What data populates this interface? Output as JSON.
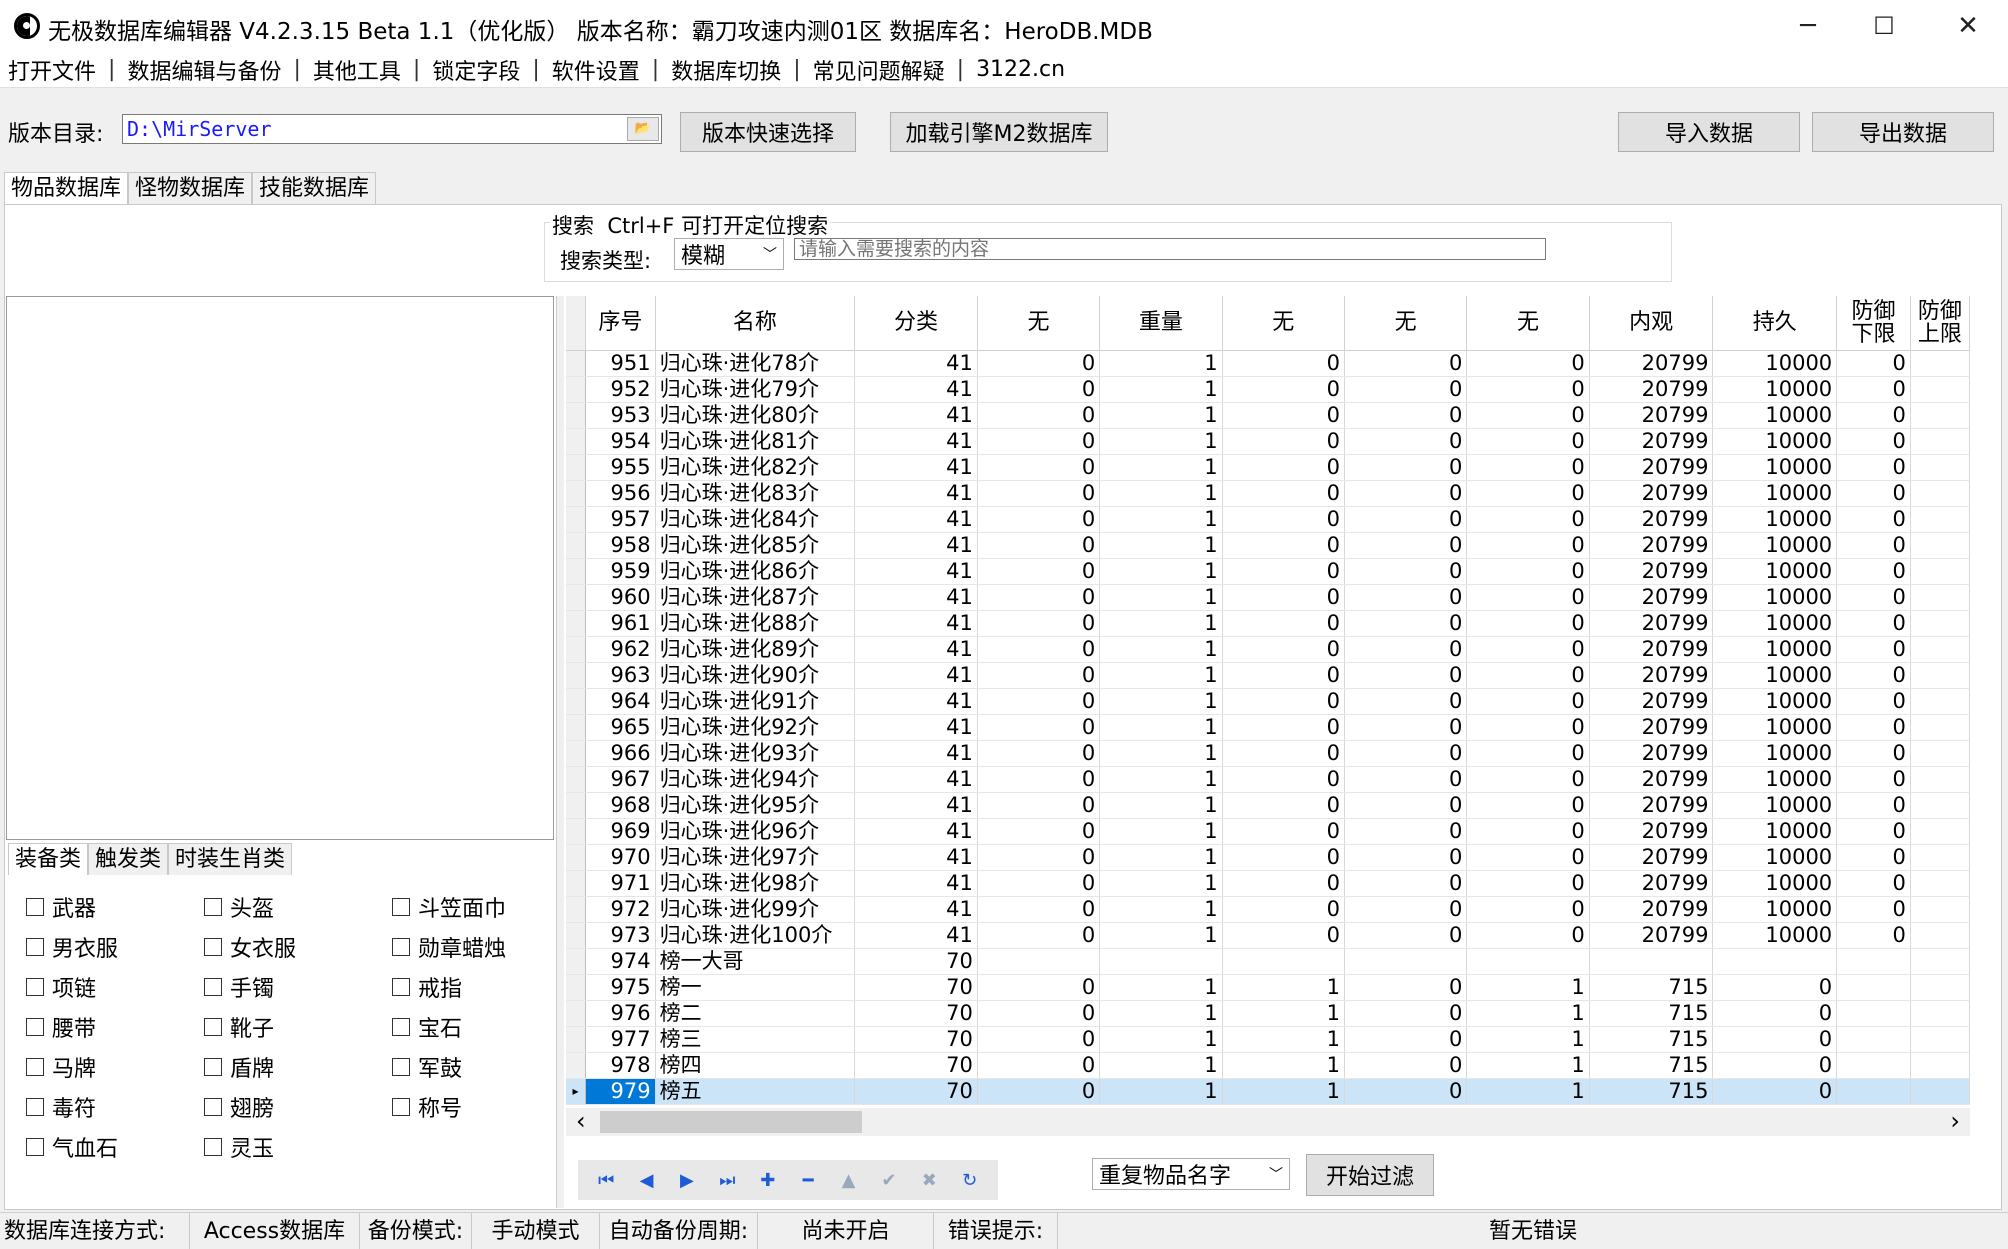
{
  "window": {
    "title": "无极数据库编辑器 V4.2.3.15    Beta 1.1（优化版）    版本名称：霸刀攻速内测01区    数据库名：HeroDB.MDB",
    "minimize": "─",
    "maximize": "☐",
    "close": "✕"
  },
  "menu": [
    "打开文件",
    "数据编辑与备份",
    "其他工具",
    "锁定字段",
    "软件设置",
    "数据库切换",
    "常见问题解疑",
    "3122.cn"
  ],
  "menu_sep": "|",
  "toolbar": {
    "dir_label": "版本目录:",
    "dir_value": "D:\\MirServer",
    "folder_icon": "📂",
    "quick_select": "版本快速选择",
    "load_engine": "加载引擎M2数据库",
    "import": "导入数据",
    "export": "导出数据"
  },
  "db_tabs": [
    "物品数据库",
    "怪物数据库",
    "技能数据库"
  ],
  "search": {
    "title": "搜索  Ctrl+F 可打开定位搜索",
    "type_label": "搜索类型:",
    "type_value": "模糊",
    "placeholder": "请输入需要搜索的内容"
  },
  "category_tabs": [
    "装备类",
    "触发类",
    "时装生肖类"
  ],
  "categories": [
    [
      "武器",
      "头盔",
      "斗笠面巾"
    ],
    [
      "男衣服",
      "女衣服",
      "勋章蜡烛"
    ],
    [
      "项链",
      "手镯",
      "戒指"
    ],
    [
      "腰带",
      "靴子",
      "宝石"
    ],
    [
      "马牌",
      "盾牌",
      "军鼓"
    ],
    [
      "毒符",
      "翅膀",
      "称号"
    ],
    [
      "气血石",
      "灵玉",
      ""
    ]
  ],
  "grid": {
    "columns": [
      "序号",
      "名称",
      "分类",
      "无",
      "重量",
      "无",
      "无",
      "无",
      "内观",
      "持久",
      "防御\n下限",
      "防御\n上限"
    ],
    "rows": [
      [
        "951",
        "归心珠·进化78介",
        "41",
        "0",
        "1",
        "0",
        "0",
        "0",
        "20799",
        "10000",
        "0",
        ""
      ],
      [
        "952",
        "归心珠·进化79介",
        "41",
        "0",
        "1",
        "0",
        "0",
        "0",
        "20799",
        "10000",
        "0",
        ""
      ],
      [
        "953",
        "归心珠·进化80介",
        "41",
        "0",
        "1",
        "0",
        "0",
        "0",
        "20799",
        "10000",
        "0",
        ""
      ],
      [
        "954",
        "归心珠·进化81介",
        "41",
        "0",
        "1",
        "0",
        "0",
        "0",
        "20799",
        "10000",
        "0",
        ""
      ],
      [
        "955",
        "归心珠·进化82介",
        "41",
        "0",
        "1",
        "0",
        "0",
        "0",
        "20799",
        "10000",
        "0",
        ""
      ],
      [
        "956",
        "归心珠·进化83介",
        "41",
        "0",
        "1",
        "0",
        "0",
        "0",
        "20799",
        "10000",
        "0",
        ""
      ],
      [
        "957",
        "归心珠·进化84介",
        "41",
        "0",
        "1",
        "0",
        "0",
        "0",
        "20799",
        "10000",
        "0",
        ""
      ],
      [
        "958",
        "归心珠·进化85介",
        "41",
        "0",
        "1",
        "0",
        "0",
        "0",
        "20799",
        "10000",
        "0",
        ""
      ],
      [
        "959",
        "归心珠·进化86介",
        "41",
        "0",
        "1",
        "0",
        "0",
        "0",
        "20799",
        "10000",
        "0",
        ""
      ],
      [
        "960",
        "归心珠·进化87介",
        "41",
        "0",
        "1",
        "0",
        "0",
        "0",
        "20799",
        "10000",
        "0",
        ""
      ],
      [
        "961",
        "归心珠·进化88介",
        "41",
        "0",
        "1",
        "0",
        "0",
        "0",
        "20799",
        "10000",
        "0",
        ""
      ],
      [
        "962",
        "归心珠·进化89介",
        "41",
        "0",
        "1",
        "0",
        "0",
        "0",
        "20799",
        "10000",
        "0",
        ""
      ],
      [
        "963",
        "归心珠·进化90介",
        "41",
        "0",
        "1",
        "0",
        "0",
        "0",
        "20799",
        "10000",
        "0",
        ""
      ],
      [
        "964",
        "归心珠·进化91介",
        "41",
        "0",
        "1",
        "0",
        "0",
        "0",
        "20799",
        "10000",
        "0",
        ""
      ],
      [
        "965",
        "归心珠·进化92介",
        "41",
        "0",
        "1",
        "0",
        "0",
        "0",
        "20799",
        "10000",
        "0",
        ""
      ],
      [
        "966",
        "归心珠·进化93介",
        "41",
        "0",
        "1",
        "0",
        "0",
        "0",
        "20799",
        "10000",
        "0",
        ""
      ],
      [
        "967",
        "归心珠·进化94介",
        "41",
        "0",
        "1",
        "0",
        "0",
        "0",
        "20799",
        "10000",
        "0",
        ""
      ],
      [
        "968",
        "归心珠·进化95介",
        "41",
        "0",
        "1",
        "0",
        "0",
        "0",
        "20799",
        "10000",
        "0",
        ""
      ],
      [
        "969",
        "归心珠·进化96介",
        "41",
        "0",
        "1",
        "0",
        "0",
        "0",
        "20799",
        "10000",
        "0",
        ""
      ],
      [
        "970",
        "归心珠·进化97介",
        "41",
        "0",
        "1",
        "0",
        "0",
        "0",
        "20799",
        "10000",
        "0",
        ""
      ],
      [
        "971",
        "归心珠·进化98介",
        "41",
        "0",
        "1",
        "0",
        "0",
        "0",
        "20799",
        "10000",
        "0",
        ""
      ],
      [
        "972",
        "归心珠·进化99介",
        "41",
        "0",
        "1",
        "0",
        "0",
        "0",
        "20799",
        "10000",
        "0",
        ""
      ],
      [
        "973",
        "归心珠·进化100介",
        "41",
        "0",
        "1",
        "0",
        "0",
        "0",
        "20799",
        "10000",
        "0",
        ""
      ],
      [
        "974",
        "榜一大哥",
        "70",
        "",
        "",
        "",
        "",
        "",
        "",
        "",
        "",
        ""
      ],
      [
        "975",
        "榜一",
        "70",
        "0",
        "1",
        "1",
        "0",
        "1",
        "715",
        "0",
        "",
        ""
      ],
      [
        "976",
        "榜二",
        "70",
        "0",
        "1",
        "1",
        "0",
        "1",
        "715",
        "0",
        "",
        ""
      ],
      [
        "977",
        "榜三",
        "70",
        "0",
        "1",
        "1",
        "0",
        "1",
        "715",
        "0",
        "",
        ""
      ],
      [
        "978",
        "榜四",
        "70",
        "0",
        "1",
        "1",
        "0",
        "1",
        "715",
        "0",
        "",
        ""
      ],
      [
        "979",
        "榜五",
        "70",
        "0",
        "1",
        "1",
        "0",
        "1",
        "715",
        "0",
        "",
        ""
      ]
    ],
    "selected_row": "979"
  },
  "scroll": {
    "left": "‹",
    "right": "›"
  },
  "nav_buttons": [
    {
      "icon": "first-icon",
      "glyph": "⏮"
    },
    {
      "icon": "prev-icon",
      "glyph": "◀"
    },
    {
      "icon": "next-icon",
      "glyph": "▶"
    },
    {
      "icon": "last-icon",
      "glyph": "⏭"
    },
    {
      "icon": "add-icon",
      "glyph": "✚"
    },
    {
      "icon": "delete-icon",
      "glyph": "━"
    },
    {
      "icon": "edit-icon",
      "glyph": "▲"
    },
    {
      "icon": "post-icon",
      "glyph": "✔"
    },
    {
      "icon": "cancel-icon",
      "glyph": "✖"
    },
    {
      "icon": "refresh-icon",
      "glyph": "↻"
    }
  ],
  "filter": {
    "select_value": "重复物品名字",
    "start": "开始过滤"
  },
  "status": {
    "conn_label": "数据库连接方式:",
    "conn_value": "Access数据库",
    "backup_label": "备份模式:",
    "backup_value": "手动模式",
    "cycle_label": "自动备份周期:",
    "cycle_value": "尚未开启",
    "error_label": "错误提示:",
    "error_value": "暂无错误"
  },
  "colors": {
    "selected_row": "#cce4f7",
    "selected_cell": "#0078d7",
    "nav_icon": "#1e5bd8",
    "dir_text": "#1a1aff"
  }
}
